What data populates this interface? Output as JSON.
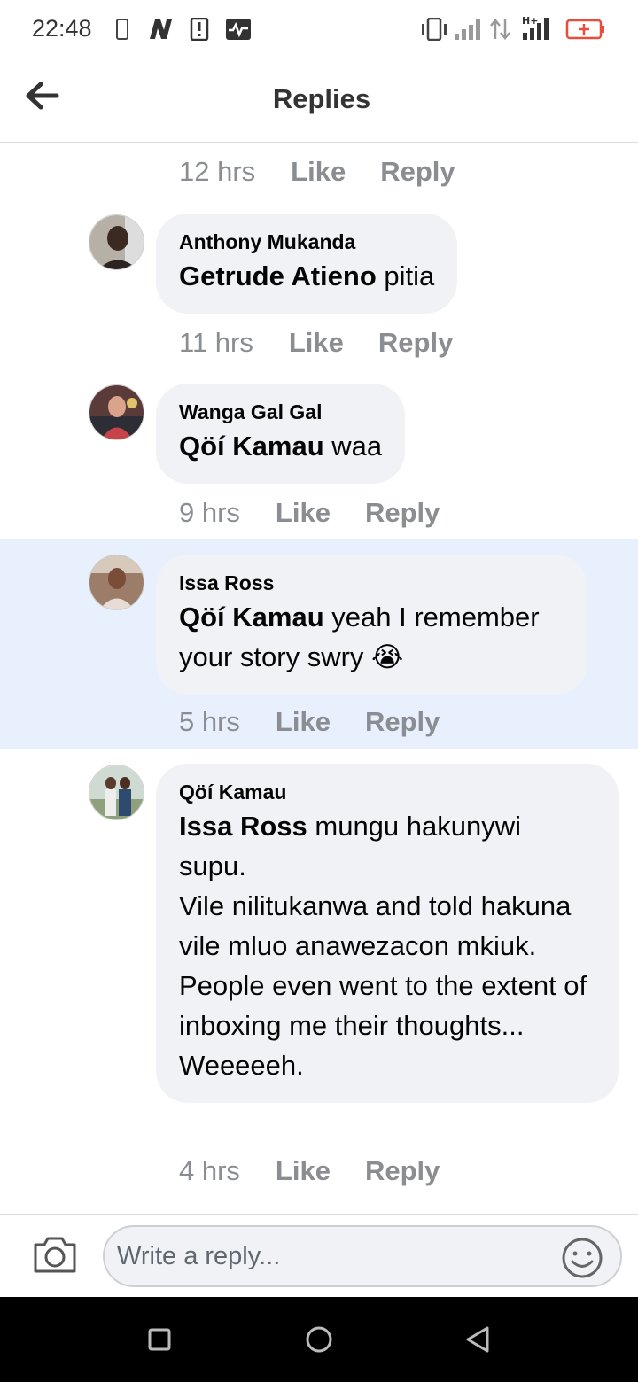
{
  "status_bar": {
    "time": "22:48",
    "icons": [
      "phone-outline-icon",
      "n-app-icon",
      "sim-alert-icon",
      "activity-icon",
      "vibrate-icon",
      "signal-icon",
      "data-arrows-icon",
      "h-plus-signal-icon",
      "battery-charging-icon"
    ],
    "battery_color": "#e74c3c"
  },
  "header": {
    "title": "Replies",
    "back_icon": "arrow-left-icon"
  },
  "colors": {
    "bubble": "#f0f2f5",
    "highlight": "#e7f0fc",
    "meta_text": "#8a8d91"
  },
  "top_meta": {
    "time": "12 hrs",
    "like": "Like",
    "reply": "Reply"
  },
  "comments": [
    {
      "author": "Anthony Mukanda",
      "mention": "Getrude Atieno",
      "text": " pitia",
      "time": "11 hrs",
      "like": "Like",
      "reply": "Reply"
    },
    {
      "author": "Wanga Gal Gal",
      "mention": "Qöí Kamau",
      "text": " waa",
      "time": "9 hrs",
      "like": "Like",
      "reply": "Reply"
    },
    {
      "author": "Issa Ross",
      "mention": "Qöí Kamau",
      "text": "  yeah I remember your story swry ",
      "emoji": "😭",
      "time": "5 hrs",
      "like": "Like",
      "reply": "Reply",
      "highlighted": true
    },
    {
      "author": "Qöí Kamau",
      "mention": "Issa Ross",
      "text": " mungu hakunywi supu.\nVile nilitukanwa and told hakuna vile mluo anawezacon mkiuk.\nPeople even went to the extent of inboxing me their thoughts...\nWeeeeeh.",
      "time": "4 hrs",
      "like": "Like",
      "reply": "Reply"
    }
  ],
  "composer": {
    "placeholder": "Write a reply...",
    "camera_icon": "camera-icon",
    "emoji_icon": "smiley-icon"
  },
  "nav_bar": {
    "icons": [
      "square-icon",
      "circle-icon",
      "triangle-back-icon"
    ]
  }
}
